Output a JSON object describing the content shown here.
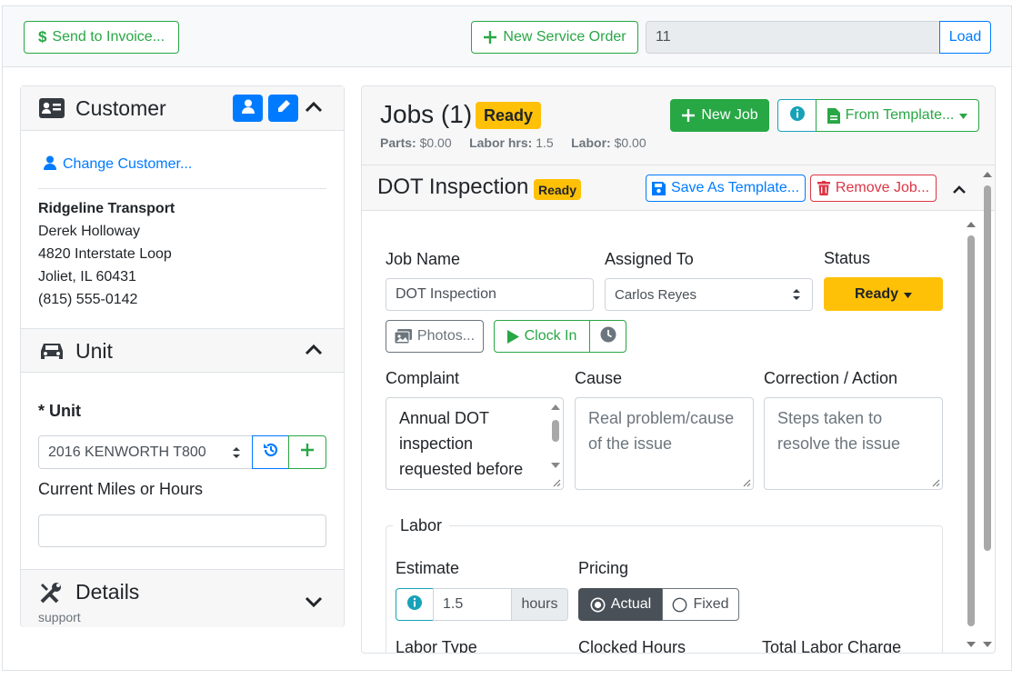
{
  "toolbar": {
    "send_to_invoice": "Send to Invoice...",
    "new_service_order": "New Service Order",
    "order_number_value": "11",
    "load_label": "Load"
  },
  "customer": {
    "title": "Customer",
    "change_customer": "Change Customer...",
    "company": "Ridgeline Transport",
    "contact": "Derek Holloway",
    "street": "4820 Interstate Loop",
    "city_state_zip": "Joliet, IL 60431",
    "phone": "(815) 555-0142"
  },
  "unit": {
    "title": "Unit",
    "unit_label": "* Unit",
    "unit_value": "2016 KENWORTH T800",
    "miles_label": "Current Miles or Hours",
    "miles_value": ""
  },
  "details": {
    "title": "Details",
    "subtitle": "support"
  },
  "jobs": {
    "title": "Jobs (1)",
    "status_badge": "Ready",
    "parts_label": "Parts:",
    "parts_value": "$0.00",
    "labor_hrs_label": "Labor hrs:",
    "labor_hrs_value": "1.5",
    "labor_label": "Labor:",
    "labor_value": "$0.00",
    "new_job": "New Job",
    "from_template": "From Template..."
  },
  "job": {
    "title": "DOT Inspection",
    "status_badge": "Ready",
    "save_as_template": "Save As Template...",
    "remove_job": "Remove Job...",
    "job_name_label": "Job Name",
    "job_name_value": "DOT Inspection",
    "assigned_to_label": "Assigned To",
    "assigned_to_value": "Carlos Reyes",
    "status_label": "Status",
    "status_value": "Ready",
    "photos": "Photos...",
    "clock_in": "Clock In",
    "complaint_label": "Complaint",
    "complaint_value": "Annual DOT inspection requested before",
    "cause_label": "Cause",
    "cause_placeholder": "Real problem/cause of the issue",
    "correction_label": "Correction / Action",
    "correction_placeholder": "Steps taken to resolve the issue"
  },
  "labor": {
    "legend": "Labor",
    "estimate_label": "Estimate",
    "estimate_value": "1.5",
    "estimate_unit": "hours",
    "pricing_label": "Pricing",
    "pricing_actual": "Actual",
    "pricing_fixed": "Fixed",
    "labor_type_label": "Labor Type",
    "clocked_hours_label": "Clocked Hours",
    "total_labor_label": "Total Labor Charge"
  },
  "colors": {
    "success": "#28a745",
    "primary": "#007bff",
    "danger": "#dc3545",
    "warning": "#ffc107",
    "info": "#17a2b8"
  }
}
